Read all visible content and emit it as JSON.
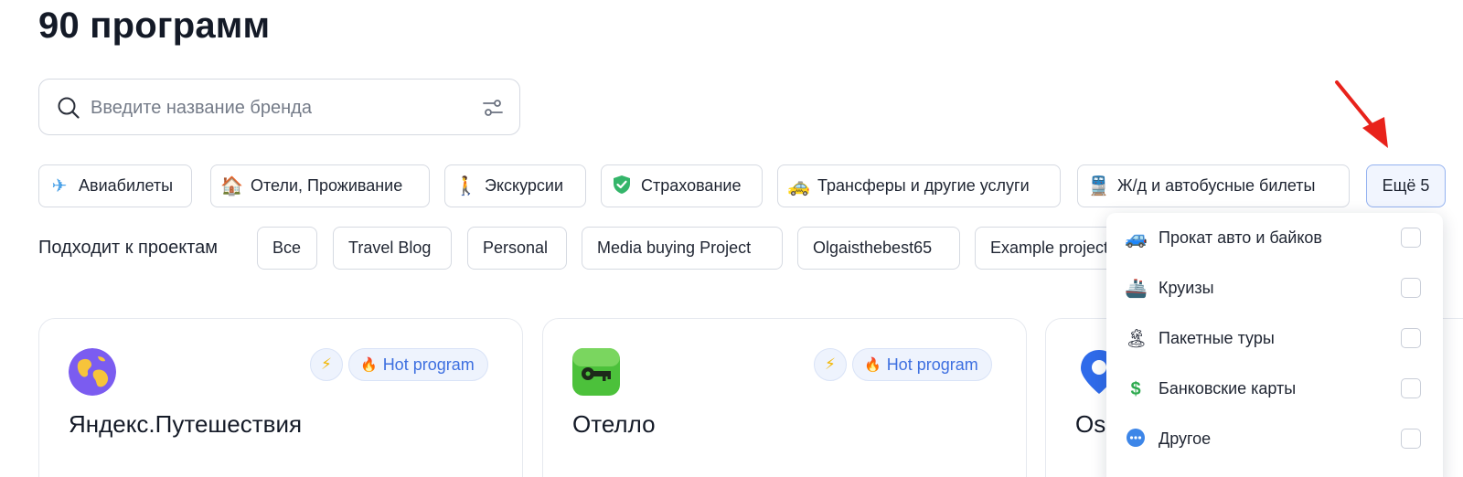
{
  "page_title": "90 программ",
  "search": {
    "placeholder": "Введите название бренда",
    "icon": "search-icon",
    "filter_icon": "filter-sliders-icon"
  },
  "categories": [
    {
      "icon": "airplane-icon",
      "emoji": "✈️",
      "label": "Авиабилеты"
    },
    {
      "icon": "house-icon",
      "emoji": "🏠",
      "label": "Отели, Проживание"
    },
    {
      "icon": "walking-person-icon",
      "emoji": "🚶",
      "label": "Экскурсии"
    },
    {
      "icon": "shield-check-icon",
      "emoji": "✔",
      "label": "Страхование"
    },
    {
      "icon": "taxi-icon",
      "emoji": "🚕",
      "label": "Трансферы и другие услуги"
    },
    {
      "icon": "train-icon",
      "emoji": "🚆",
      "label": "Ж/д и автобусные билеты"
    }
  ],
  "more_button": {
    "label": "Ещё 5"
  },
  "projects": {
    "label": "Подходит к проектам",
    "items": [
      "Все",
      "Travel Blog",
      "Personal",
      "Media buying Project",
      "Olgaisthebest65",
      "Example project"
    ]
  },
  "cards": [
    {
      "name": "Яндекс.Путешествия",
      "logo": "globe-logo",
      "hot_label": "Hot program"
    },
    {
      "name": "Отелло",
      "logo": "key-logo",
      "hot_label": "Hot program"
    },
    {
      "name": "Os",
      "logo": "location-pin-logo",
      "hot_label": ""
    }
  ],
  "dropdown": {
    "items": [
      {
        "icon": "car-icon",
        "emoji": "🚙",
        "label": "Прокат авто и байков",
        "checked": false
      },
      {
        "icon": "ship-icon",
        "emoji": "🚢",
        "label": "Круизы",
        "checked": false
      },
      {
        "icon": "beach-umbrella-icon",
        "emoji": "🏝️",
        "label": "Пакетные туры",
        "checked": false
      },
      {
        "icon": "dollar-icon",
        "emoji": "💲",
        "label": "Банковские карты",
        "checked": false
      },
      {
        "icon": "more-dots-icon",
        "emoji": "•••",
        "label": "Другое",
        "checked": false
      }
    ]
  },
  "colors": {
    "accent": "#3d6fe0",
    "more_button_border": "#94b2f0",
    "arrow": "#e8221b"
  }
}
